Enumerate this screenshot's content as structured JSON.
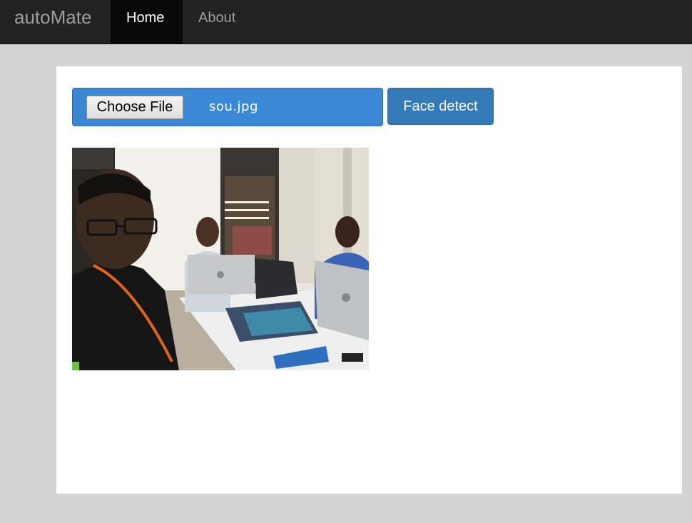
{
  "navbar": {
    "brand": "autoMate",
    "items": [
      {
        "label": "Home",
        "active": true
      },
      {
        "label": "About",
        "active": false
      }
    ]
  },
  "upload": {
    "choose_label": "Choose File",
    "file_name": "sou.jpg",
    "detect_label": "Face detect"
  },
  "colors": {
    "navbar_bg": "#222222",
    "page_bg": "#d3d3d3",
    "primary": "#337ab7"
  }
}
